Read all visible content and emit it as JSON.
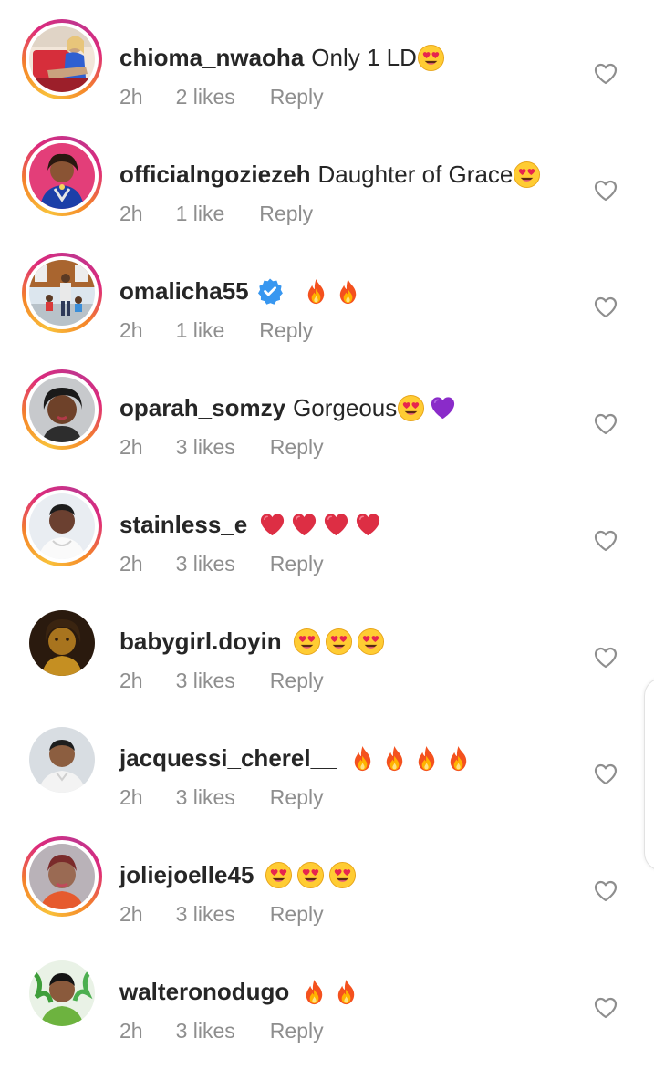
{
  "comments": [
    {
      "username": "chioma_nwaoha",
      "text": "Only 1 LD",
      "emojis": [
        "heart-eyes"
      ],
      "verified": false,
      "time": "2h",
      "likes": "2 likes",
      "reply": "Reply",
      "story_ring": true,
      "avatar_icon": "avatar-chioma-nwaoha"
    },
    {
      "username": "officialngoziezeh",
      "text": "Daughter of Grace",
      "emojis": [
        "heart-eyes"
      ],
      "verified": false,
      "time": "2h",
      "likes": "1 like",
      "reply": "Reply",
      "story_ring": true,
      "avatar_icon": "avatar-officialngoziezeh"
    },
    {
      "username": "omalicha55",
      "text": "",
      "emojis": [
        "fire",
        "fire"
      ],
      "verified": true,
      "time": "2h",
      "likes": "1 like",
      "reply": "Reply",
      "story_ring": true,
      "avatar_icon": "avatar-omalicha55"
    },
    {
      "username": "oparah_somzy",
      "text": "Gorgeous",
      "emojis": [
        "heart-eyes",
        "purple-heart"
      ],
      "verified": false,
      "time": "2h",
      "likes": "3 likes",
      "reply": "Reply",
      "story_ring": true,
      "avatar_icon": "avatar-oparah-somzy"
    },
    {
      "username": "stainless_e",
      "text": "",
      "emojis": [
        "red-heart",
        "red-heart",
        "red-heart",
        "red-heart"
      ],
      "verified": false,
      "time": "2h",
      "likes": "3 likes",
      "reply": "Reply",
      "story_ring": true,
      "avatar_icon": "avatar-stainless-e"
    },
    {
      "username": "babygirl.doyin",
      "text": "",
      "emojis": [
        "heart-eyes",
        "heart-eyes",
        "heart-eyes"
      ],
      "verified": false,
      "time": "2h",
      "likes": "3 likes",
      "reply": "Reply",
      "story_ring": false,
      "avatar_icon": "avatar-babygirl-doyin"
    },
    {
      "username": "jacquessi_cherel__",
      "text": "",
      "emojis": [
        "fire",
        "fire",
        "fire",
        "fire"
      ],
      "verified": false,
      "time": "2h",
      "likes": "3 likes",
      "reply": "Reply",
      "story_ring": false,
      "avatar_icon": "avatar-jacquessi-cherel"
    },
    {
      "username": "joliejoelle45",
      "text": "",
      "emojis": [
        "heart-eyes",
        "heart-eyes",
        "heart-eyes"
      ],
      "verified": false,
      "time": "2h",
      "likes": "3 likes",
      "reply": "Reply",
      "story_ring": true,
      "avatar_icon": "avatar-joliejoelle45"
    },
    {
      "username": "walteronodugo",
      "text": "",
      "emojis": [
        "fire",
        "fire"
      ],
      "verified": false,
      "time": "2h",
      "likes": "3 likes",
      "reply": "Reply",
      "story_ring": false,
      "avatar_icon": "avatar-walteronodugo"
    }
  ],
  "colors": {
    "username": "#262626",
    "meta": "#8e8e8e",
    "verified": "#3897f0",
    "story_ring_start": "#f9c13a",
    "story_ring_end": "#dd2a7b"
  },
  "icons": {
    "like": "heart-outline-icon",
    "verified": "verified-badge-icon"
  }
}
